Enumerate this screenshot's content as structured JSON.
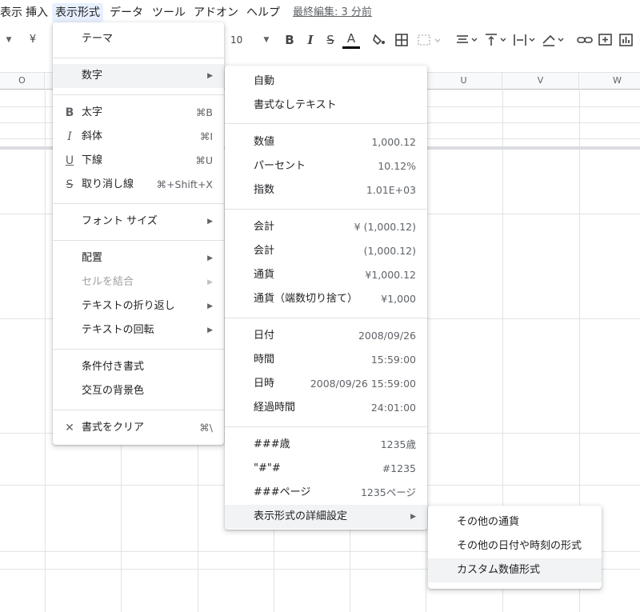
{
  "menubar": {
    "items": [
      "表示",
      "挿入",
      "表示形式",
      "データ",
      "ツール",
      "アドオン",
      "ヘルプ"
    ],
    "last_edit": "最終編集: 3 分前"
  },
  "toolbar": {
    "currency": "¥",
    "font_size": "10"
  },
  "columns": [
    "O",
    "U",
    "V",
    "W"
  ],
  "format_menu": {
    "theme": "テーマ",
    "number": "数字",
    "bold": "太字",
    "bold_sc": "⌘B",
    "italic": "斜体",
    "italic_sc": "⌘I",
    "underline": "下線",
    "underline_sc": "⌘U",
    "strike": "取り消し線",
    "strike_sc": "⌘+Shift+X",
    "font_size": "フォント サイズ",
    "align": "配置",
    "merge": "セルを結合",
    "wrap": "テキストの折り返し",
    "rotate": "テキストの回転",
    "conditional": "条件付き書式",
    "alternating": "交互の背景色",
    "clear": "書式をクリア",
    "clear_sc": "⌘\\"
  },
  "number_menu": {
    "auto": "自動",
    "plain": "書式なしテキスト",
    "items": [
      {
        "label": "数値",
        "value": "1,000.12"
      },
      {
        "label": "パーセント",
        "value": "10.12%"
      },
      {
        "label": "指数",
        "value": "1.01E+03"
      },
      {
        "label": "会計",
        "value": "¥ (1,000.12)"
      },
      {
        "label": "会計",
        "value": "(1,000.12)"
      },
      {
        "label": "通貨",
        "value": "¥1,000.12"
      },
      {
        "label": "通貨（端数切り捨て）",
        "value": "¥1,000"
      },
      {
        "label": "日付",
        "value": "2008/09/26"
      },
      {
        "label": "時間",
        "value": "15:59:00"
      },
      {
        "label": "日時",
        "value": "2008/09/26 15:59:00"
      },
      {
        "label": "経過時間",
        "value": "24:01:00"
      },
      {
        "label": "###歳",
        "value": "1235歳"
      },
      {
        "label": "\"#\"#",
        "value": "#1235"
      },
      {
        "label": "###ページ",
        "value": "1235ページ"
      }
    ],
    "more": "表示形式の詳細設定"
  },
  "more_menu": {
    "currency": "その他の通貨",
    "datetime": "その他の日付や時刻の形式",
    "custom": "カスタム数値形式"
  }
}
